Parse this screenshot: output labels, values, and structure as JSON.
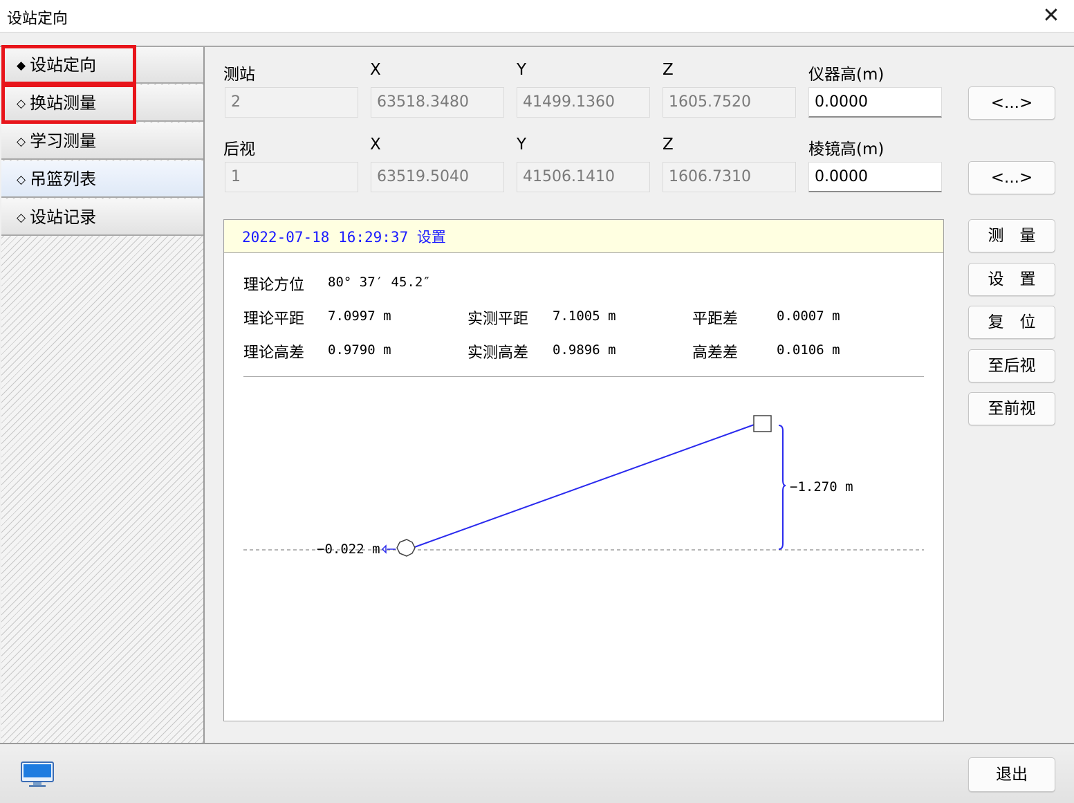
{
  "window": {
    "title": "设站定向",
    "close_glyph": "✕"
  },
  "sidebar": {
    "items": [
      {
        "label": "设站定向",
        "marker": "◆",
        "highlighted": true
      },
      {
        "label": "换站测量",
        "marker": "◇",
        "highlighted": true
      },
      {
        "label": "学习测量",
        "marker": "◇"
      },
      {
        "label": "吊篮列表",
        "marker": "◇",
        "selected": true
      },
      {
        "label": "设站记录",
        "marker": "◇"
      }
    ]
  },
  "station": {
    "label": "测站",
    "x_label": "X",
    "y_label": "Y",
    "z_label": "Z",
    "h_label": "仪器高(m)",
    "id": "2",
    "x": "63518.3480",
    "y": "41499.1360",
    "z": "1605.7520",
    "h": "0.0000",
    "pick_label": "<...>"
  },
  "backsight": {
    "label": "后视",
    "x_label": "X",
    "y_label": "Y",
    "z_label": "Z",
    "h_label": "棱镜高(m)",
    "id": "1",
    "x": "63519.5040",
    "y": "41506.1410",
    "z": "1606.7310",
    "h": "0.0000",
    "pick_label": "<...>"
  },
  "result": {
    "header": "2022-07-18 16:29:37 设置",
    "azimuth_label": "理论方位",
    "azimuth_value": "80° 37′ 45.2″",
    "theo_dist_label": "理论平距",
    "theo_dist_value": "7.0997 m",
    "meas_dist_label": "实测平距",
    "meas_dist_value": "7.1005 m",
    "dist_diff_label": "平距差",
    "dist_diff_value": "0.0007 m",
    "theo_height_label": "理论高差",
    "theo_height_value": "0.9790 m",
    "meas_height_label": "实测高差",
    "meas_height_value": "0.9896 m",
    "height_diff_label": "高差差",
    "height_diff_value": "0.0106 m",
    "diagram": {
      "left_label": "−0.022 m",
      "right_label": "−1.270 m",
      "line_color": "#2a2aee"
    }
  },
  "actions": {
    "measure": "测　量",
    "set": "设　置",
    "reset": "复　位",
    "to_back": "至后视",
    "to_front": "至前视"
  },
  "footer": {
    "exit": "退出",
    "icon": "monitor-icon"
  },
  "colors": {
    "highlight_box": "#e8141a",
    "header_bg": "#ffffe1",
    "header_text": "#1a1aff"
  }
}
